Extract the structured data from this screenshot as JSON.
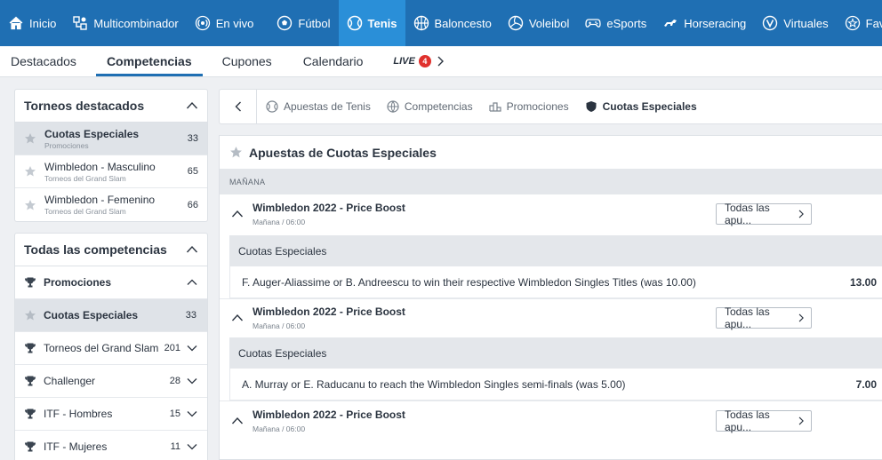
{
  "topnav": {
    "items": [
      {
        "label": "Inicio",
        "icon": "home-icon"
      },
      {
        "label": "Multicombinador",
        "icon": "multicombinador-icon"
      },
      {
        "label": "En vivo",
        "icon": "live-broadcast-icon"
      },
      {
        "label": "Fútbol",
        "icon": "soccer-ball-icon"
      },
      {
        "label": "Tenis",
        "icon": "tennis-ball-icon",
        "active": true
      },
      {
        "label": "Baloncesto",
        "icon": "basketball-icon"
      },
      {
        "label": "Voleibol",
        "icon": "volleyball-icon"
      },
      {
        "label": "eSports",
        "icon": "gamepad-icon"
      },
      {
        "label": "Horseracing",
        "icon": "horse-icon"
      },
      {
        "label": "Virtuales",
        "icon": "virtual-v-icon"
      },
      {
        "label": "Favoritos",
        "icon": "star-icon"
      }
    ]
  },
  "subnav": {
    "items": [
      "Destacados",
      "Competencias",
      "Cupones",
      "Calendario"
    ],
    "active": "Competencias",
    "live_label": "LIVE",
    "live_count": "4"
  },
  "featured": {
    "title": "Torneos destacados",
    "items": [
      {
        "name": "Cuotas Especiales",
        "sub": "Promociones",
        "count": "33"
      },
      {
        "name": "Wimbledon - Masculino",
        "sub": "Torneos del Grand Slam",
        "count": "65"
      },
      {
        "name": "Wimbledon - Femenino",
        "sub": "Torneos del Grand Slam",
        "count": "66"
      }
    ]
  },
  "competitions": {
    "title": "Todas las competencias",
    "promo_label": "Promociones",
    "promo_child": {
      "name": "Cuotas Especiales",
      "count": "33"
    },
    "items": [
      {
        "name": "Torneos del Grand Slam",
        "count": "201"
      },
      {
        "name": "Challenger",
        "count": "28"
      },
      {
        "name": "ITF - Hombres",
        "count": "15"
      },
      {
        "name": "ITF - Mujeres",
        "count": "11"
      }
    ]
  },
  "breadcrumb": {
    "items": [
      "Apuestas de Tenis",
      "Competencias",
      "Promociones",
      "Cuotas Especiales"
    ]
  },
  "main": {
    "title": "Apuestas de Cuotas Especiales",
    "day": "MAÑANA",
    "all_label": "Todas las apu...",
    "events": [
      {
        "name": "Wimbledon 2022 - Price Boost",
        "time": "Mañana / 06:00",
        "market": "Cuotas Especiales",
        "selection": "F. Auger-Aliassime or B. Andreescu to win their respective Wimbledon Singles Titles (was 10.00)",
        "odds": "13.00"
      },
      {
        "name": "Wimbledon 2022 - Price Boost",
        "time": "Mañana / 06:00",
        "market": "Cuotas Especiales",
        "selection": "A. Murray or E. Raducanu to reach the Wimbledon Singles semi-finals (was 5.00)",
        "odds": "7.00"
      },
      {
        "name": "Wimbledon 2022 - Price Boost",
        "time": "Mañana / 06:00"
      }
    ]
  },
  "colors": {
    "brand": "#1f6fb3",
    "active_tab": "#2a8fd8",
    "live_badge": "#e0312d"
  }
}
